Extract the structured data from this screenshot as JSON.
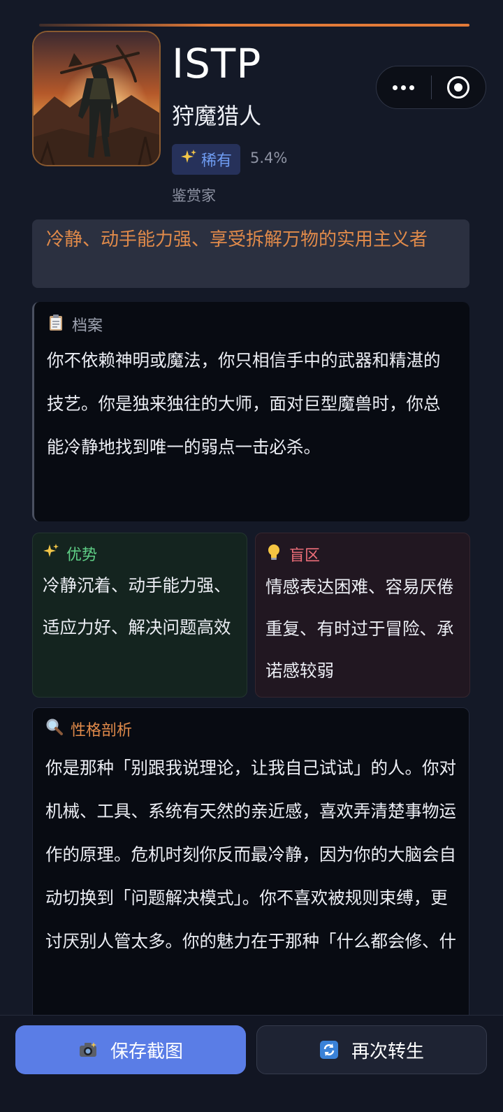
{
  "header": {
    "type_code": "ISTP",
    "type_name": "狩魔猎人",
    "rarity_label": "稀有",
    "rarity_percent": "5.4%",
    "subtype": "鉴赏家"
  },
  "tagline": "冷静、动手能力强、享受拆解万物的实用主义者",
  "profile": {
    "title": "档案",
    "text": "你不依赖神明或魔法，你只相信手中的武器和精湛的技艺。你是独来独往的大师，面对巨型魔兽时，你总能冷静地找到唯一的弱点一击必杀。"
  },
  "strengths": {
    "title": "优势",
    "text": "冷静沉着、动手能力强、适应力好、解决问题高效"
  },
  "blind_spots": {
    "title": "盲区",
    "text": "情感表达困难、容易厌倦重复、有时过于冒险、承诺感较弱"
  },
  "analysis": {
    "title": "性格剖析",
    "text": "你是那种「别跟我说理论，让我自己试试」的人。你对机械、工具、系统有天然的亲近感，喜欢弄清楚事物运作的原理。危机时刻你反而最冷静，因为你的大脑会自动切换到「问题解决模式」。你不喜欢被规则束缚，更讨厌别人管太多。你的魅力在于那种「什么都会修、什"
  },
  "actions": {
    "save_label": "保存截图",
    "reborn_label": "再次转生"
  },
  "icons": {
    "rarity": "sparkles-icon",
    "profile": "clipboard-icon",
    "strengths": "sparkles-icon",
    "blind_spots": "lightbulb-icon",
    "analysis": "magnifier-icon",
    "save": "camera-icon",
    "reborn": "refresh-icon",
    "capsule_more": "more-dots-icon",
    "capsule_close": "target-icon"
  },
  "colors": {
    "accent": "#e27a38",
    "primary_button": "#5a7de6",
    "strength": "#5fcf86",
    "blind_spot": "#ee6f7a",
    "rarity": "#6f9cf2"
  }
}
